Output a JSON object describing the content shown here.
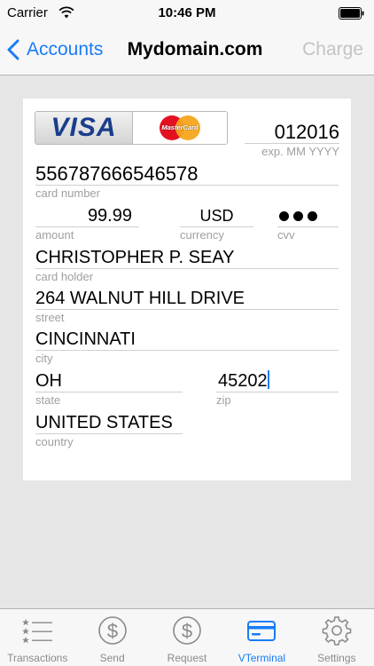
{
  "status": {
    "carrier": "Carrier",
    "time": "10:46 PM"
  },
  "nav": {
    "back_label": "Accounts",
    "title": "Mydomain.com",
    "action_label": "Charge"
  },
  "card_logos": {
    "visa": "VISA",
    "mastercard": "MasterCard"
  },
  "form": {
    "expiry": {
      "value": "012016",
      "label": "exp. MM YYYY"
    },
    "card_number": {
      "value": "556787666546578",
      "label": "card number"
    },
    "amount": {
      "value": "99.99",
      "label": "amount"
    },
    "currency": {
      "value": "USD",
      "label": "currency"
    },
    "cvv": {
      "masked_length": 3,
      "label": "cvv"
    },
    "card_holder": {
      "value": "CHRISTOPHER P. SEAY",
      "label": "card holder"
    },
    "street": {
      "value": "264 WALNUT HILL DRIVE",
      "label": "street"
    },
    "city": {
      "value": "CINCINNATI",
      "label": "city"
    },
    "state": {
      "value": "OH",
      "label": "state"
    },
    "zip": {
      "value": "45202",
      "label": "zip"
    },
    "country": {
      "value": "UNITED STATES",
      "label": "country"
    }
  },
  "tabs": [
    {
      "label": "Transactions",
      "icon": "list-icon",
      "active": false
    },
    {
      "label": "Send",
      "icon": "dollar-icon",
      "active": false
    },
    {
      "label": "Request",
      "icon": "dollar-icon",
      "active": false
    },
    {
      "label": "VTerminal",
      "icon": "credit-card-icon",
      "active": true
    },
    {
      "label": "Settings",
      "icon": "gear-icon",
      "active": false
    }
  ],
  "colors": {
    "accent": "#1a7cf7",
    "background": "#e6e6e6",
    "inactive_tab": "#8a8a8a",
    "disabled_action": "#c4c4c4"
  }
}
